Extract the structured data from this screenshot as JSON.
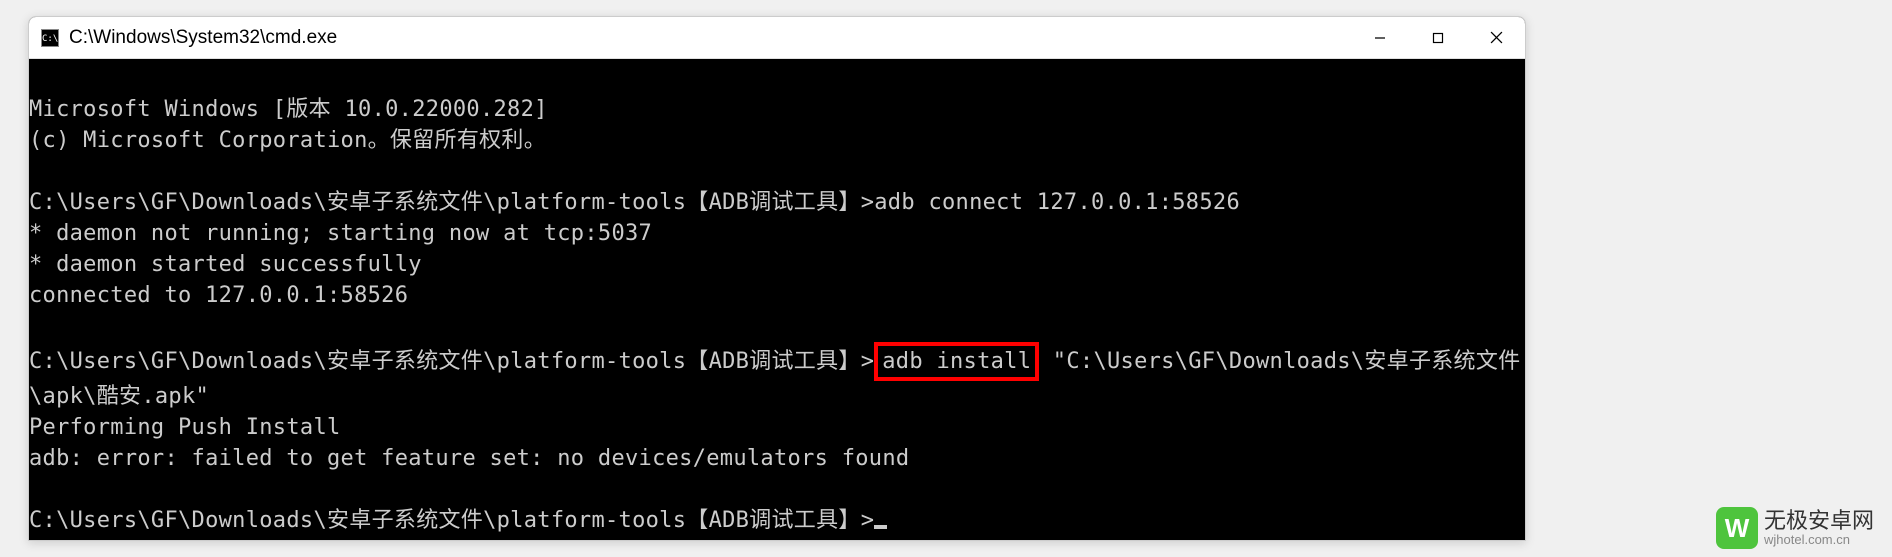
{
  "window": {
    "icon_label": "C:\\",
    "title": "C:\\Windows\\System32\\cmd.exe"
  },
  "terminal": {
    "line1": "Microsoft Windows [版本 10.0.22000.282]",
    "line2": "(c) Microsoft Corporation。保留所有权利。",
    "blank1": "",
    "prompt1": "C:\\Users\\GF\\Downloads\\安卓子系统文件\\platform-tools【ADB调试工具】>",
    "cmd1": "adb connect 127.0.0.1:58526",
    "out1": "* daemon not running; starting now at tcp:5037",
    "out2": "* daemon started successfully",
    "out3": "connected to 127.0.0.1:58526",
    "blank2": "",
    "prompt2": "C:\\Users\\GF\\Downloads\\安卓子系统文件\\platform-tools【ADB调试工具】>",
    "cmd2_highlight": "adb install",
    "cmd2_tail": " \"C:\\Users\\GF\\Downloads\\安卓子系统文件\\apk\\酷安.apk\"",
    "out4": "Performing Push Install",
    "out5": "adb: error: failed to get feature set: no devices/emulators found",
    "blank3": "",
    "prompt3": "C:\\Users\\GF\\Downloads\\安卓子系统文件\\platform-tools【ADB调试工具】>"
  },
  "watermark": {
    "logo_letter": "W",
    "title": "无极安卓网",
    "url": "wjhotel.com.cn"
  }
}
